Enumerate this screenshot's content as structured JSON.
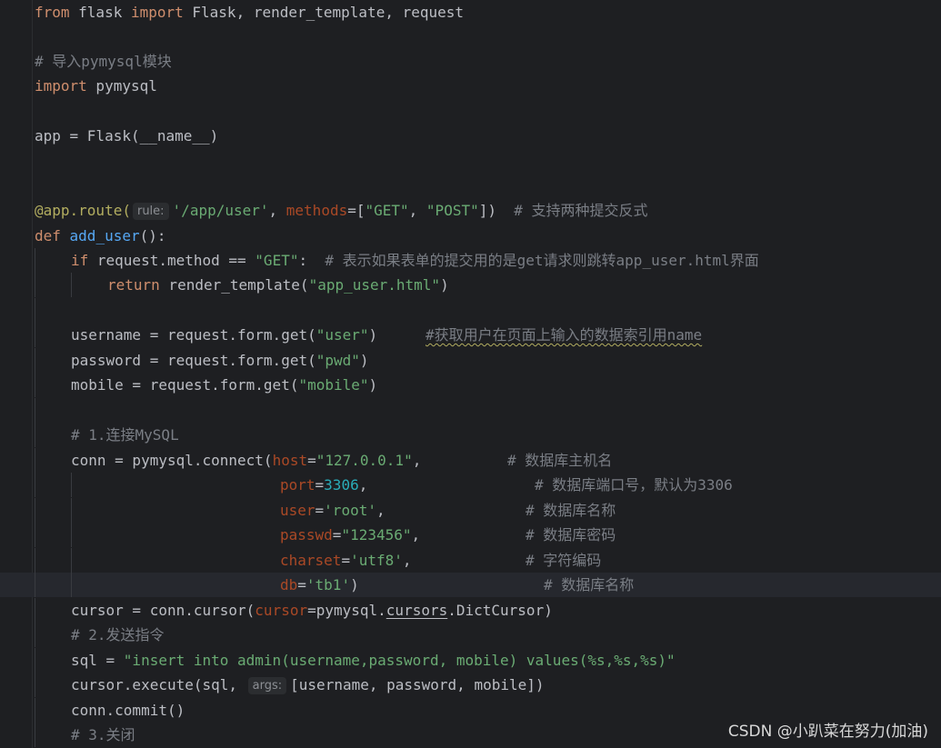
{
  "code": {
    "l1": {
      "kw_from": "from",
      "mod_flask": " flask ",
      "kw_import": "import",
      "names": " Flask, render_template, request"
    },
    "l3": {
      "comment": "# 导入pymysql模块"
    },
    "l4": {
      "kw_import": "import",
      "mod": " pymysql"
    },
    "l6": {
      "text": "app = Flask(__name__)"
    },
    "l9": {
      "decorator": "@app.route(",
      "hint": "rule:",
      "route": "'/app/user'",
      "sep": ", ",
      "param": "methods",
      "eq": "=[",
      "get": "\"GET\"",
      "comma": ", ",
      "post": "\"POST\"",
      "close": "])",
      "comment": "  # 支持两种提交反式"
    },
    "l10": {
      "kw_def": "def",
      "fname": " add_user",
      "rest": "():"
    },
    "l11": {
      "kw_if": "if",
      "cond": " request.method == ",
      "get": "\"GET\"",
      "colon": ":",
      "comment": "  # 表示如果表单的提交用的是get请求则跳转app_user.html界面"
    },
    "l12": {
      "kw_return": "return",
      "call": " render_template(",
      "tpl": "\"app_user.html\"",
      "close": ")"
    },
    "l14": {
      "lhs": "username = request.form.get(",
      "arg": "\"user\"",
      "close": ")",
      "comment": "#获取用户在页面上输入的数据索引用name"
    },
    "l15": {
      "lhs": "password = request.form.get(",
      "arg": "\"pwd\"",
      "close": ")"
    },
    "l16": {
      "lhs": "mobile = request.form.get(",
      "arg": "\"mobile\"",
      "close": ")"
    },
    "l18": {
      "comment": "# 1.连接MySQL"
    },
    "l19": {
      "lhs": "conn = pymysql.connect(",
      "param": "host",
      "eq": "=",
      "val": "\"127.0.0.1\"",
      "comma": ",",
      "comment": "# 数据库主机名"
    },
    "l20": {
      "param": "port",
      "eq": "=",
      "val": "3306",
      "comma": ",",
      "comment": "# 数据库端口号，默认为3306"
    },
    "l21": {
      "param": "user",
      "eq": "=",
      "val": "'root'",
      "comma": ",",
      "comment": "# 数据库名称"
    },
    "l22": {
      "param": "passwd",
      "eq": "=",
      "val": "\"123456\"",
      "comma": ",",
      "comment": "# 数据库密码"
    },
    "l23": {
      "param": "charset",
      "eq": "=",
      "val": "'utf8'",
      "comma": ",",
      "comment": "# 字符编码"
    },
    "l24": {
      "param": "db",
      "eq": "=",
      "val": "'tb1'",
      "close": ")",
      "comment": "# 数据库名称"
    },
    "l25": {
      "lhs": "cursor = conn.cursor(",
      "param": "cursor",
      "eq": "=pymysql.",
      "attr": "cursors",
      "rest": ".DictCursor)"
    },
    "l26": {
      "comment": "# 2.发送指令"
    },
    "l27": {
      "lhs": "sql = ",
      "val": "\"insert into admin(username,password, mobile) values(%s,%s,%s)\""
    },
    "l28": {
      "lhs": "cursor.execute(sql, ",
      "hint": "args:",
      "rest": "[username, password, mobile])"
    },
    "l29": {
      "text": "conn.commit()"
    },
    "l30": {
      "comment": "# 3.关闭"
    }
  },
  "watermark": "CSDN @小趴菜在努力(加油)"
}
